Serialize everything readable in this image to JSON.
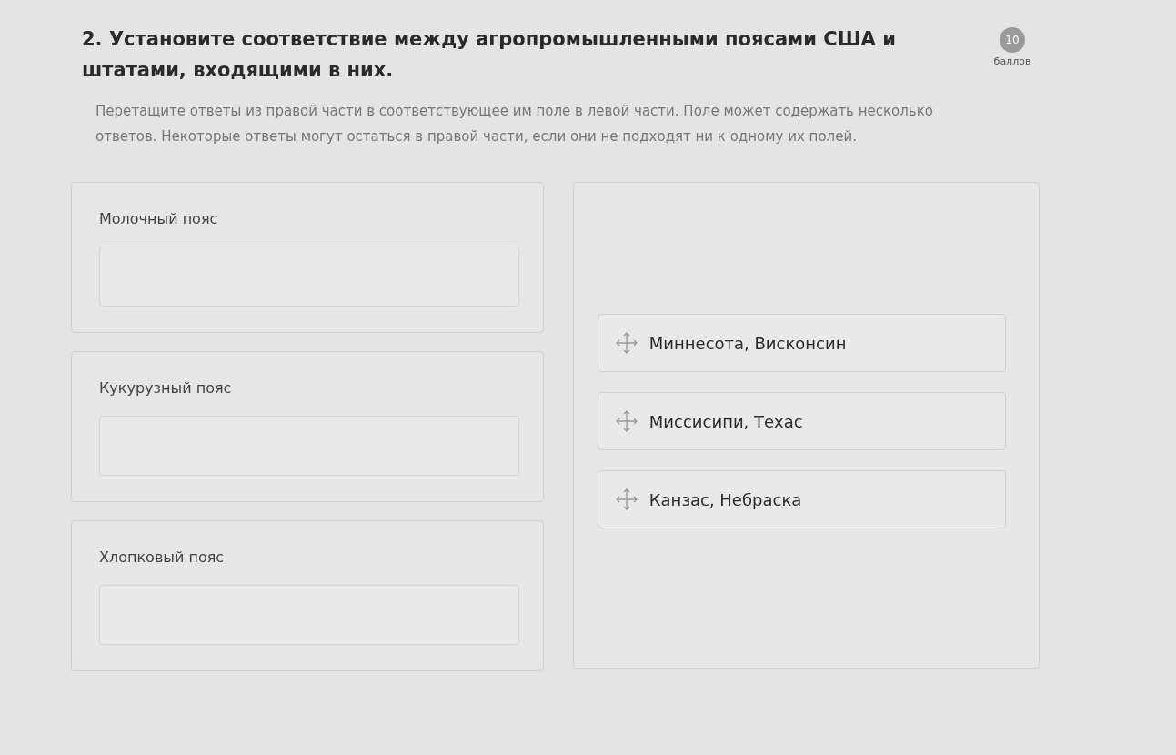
{
  "question": {
    "title": "2. Установите соответствие между агропромышленными поясами США и штатами, входящими в них.",
    "points": "10",
    "points_label": "баллов"
  },
  "instructions": "Перетащите ответы из правой части в соответствующее им поле в левой части. Поле может содержать несколько ответов. Некоторые ответы могут остаться в правой части, если они не подходят ни к одному их полей.",
  "targets": [
    {
      "label": "Молочный пояс"
    },
    {
      "label": "Кукурузный пояс"
    },
    {
      "label": "Хлопковый пояс"
    }
  ],
  "answers": [
    {
      "label": "Миннесота, Висконсин"
    },
    {
      "label": "Миссисипи, Техас"
    },
    {
      "label": "Канзас, Небраска"
    }
  ]
}
